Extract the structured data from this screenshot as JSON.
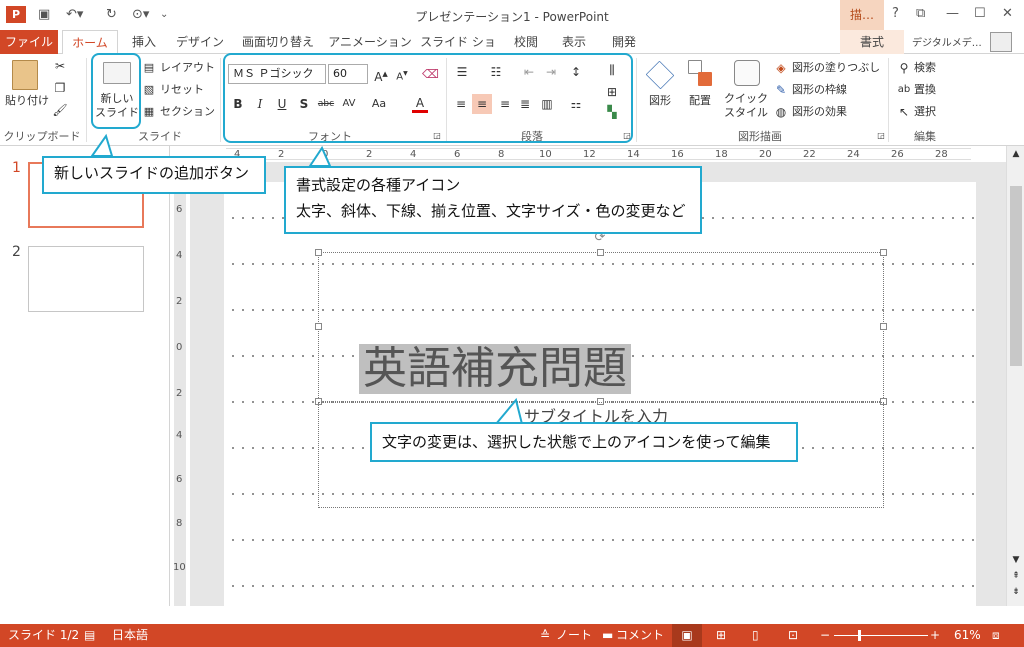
{
  "title_bar": {
    "app_logo": "P",
    "document_title": "プレゼンテーション1 - PowerPoint",
    "context_tab_title": "描…",
    "buttons": {
      "help": "?",
      "ribbon_display": "⧉",
      "minimize": "—",
      "maximize": "☐",
      "close": "✕"
    }
  },
  "tabs": {
    "file": "ファイル",
    "items": [
      "ホーム",
      "挿入",
      "デザイン",
      "画面切り替え",
      "アニメーション",
      "スライド ショー",
      "校閲",
      "表示",
      "開発"
    ],
    "active": "ホーム",
    "context": "書式",
    "user_name": "デジタルメデ…"
  },
  "ribbon": {
    "clipboard": {
      "paste": "貼り付け",
      "label": "クリップボード"
    },
    "slides": {
      "new_slide": "新しい\nスライド",
      "new_slide_line1": "新しい",
      "new_slide_line2": "スライド",
      "layout": "レイアウト",
      "reset": "リセット",
      "section": "セクション",
      "label": "スライド"
    },
    "font": {
      "font_name": "ＭＳ Ｐゴシック",
      "font_size": "60",
      "bold": "B",
      "italic": "I",
      "underline": "U",
      "shadow": "S",
      "strike": "abc",
      "spacing": "AV",
      "case": "Aa",
      "color": "A",
      "label": "フォント"
    },
    "paragraph": {
      "label": "段落"
    },
    "drawing": {
      "shapes": "図形",
      "arrange": "配置",
      "quick_styles_line1": "クイック",
      "quick_styles_line2": "スタイル",
      "fill": "図形の塗りつぶし",
      "outline": "図形の枠線",
      "effects": "図形の効果",
      "label": "図形描画"
    },
    "editing": {
      "find": "検索",
      "replace": "置換",
      "select": "選択",
      "label": "編集"
    }
  },
  "ruler": {
    "h_ticks": [
      "4",
      "2",
      "0",
      "2",
      "4",
      "6",
      "8",
      "10",
      "12",
      "14",
      "16",
      "18",
      "20",
      "22",
      "24",
      "26",
      "28"
    ],
    "v_ticks": [
      "6",
      "4",
      "2",
      "0",
      "2",
      "4",
      "6",
      "8",
      "10"
    ]
  },
  "thumbnails": [
    {
      "num": "1",
      "selected": true
    },
    {
      "num": "2",
      "selected": false
    }
  ],
  "slide": {
    "title": "英語補充問題",
    "subtitle_placeholder": "サブタイトルを入力"
  },
  "callouts": {
    "new_slide": "新しいスライドの追加ボタン",
    "format_line1": "書式設定の各種アイコン",
    "format_line2": "太字、斜体、下線、揃え位置、文字サイズ・色の変更など",
    "edit_text": "文字の変更は、選択した状態で上のアイコンを使って編集"
  },
  "status_bar": {
    "slide_info": "スライド 1/2",
    "language": "日本語",
    "notes": "ノート",
    "comments": "コメント",
    "zoom": "61%"
  },
  "colors": {
    "accent": "#d24726",
    "callout_border": "#22a9cf",
    "selection": "#bfbfbf"
  }
}
